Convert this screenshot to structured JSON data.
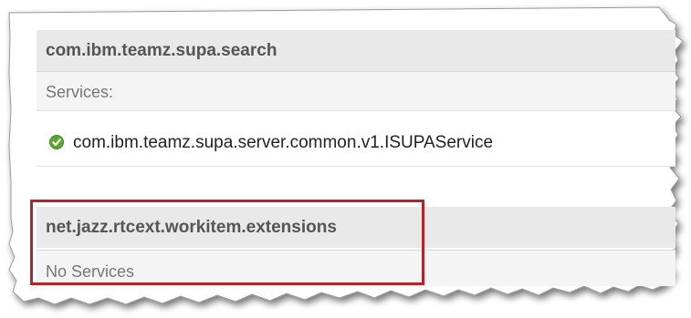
{
  "sections": [
    {
      "header": "com.ibm.teamz.supa.search",
      "services_label": "Services:",
      "services": [
        {
          "name": "com.ibm.teamz.supa.server.common.v1.ISUPAService",
          "status_icon": "check-circle-icon",
          "status_color": "#5aa832"
        }
      ]
    },
    {
      "header": "net.jazz.rtcext.workitem.extensions",
      "services_label": "No Services",
      "services": []
    }
  ],
  "highlight_color": "#b0252b"
}
